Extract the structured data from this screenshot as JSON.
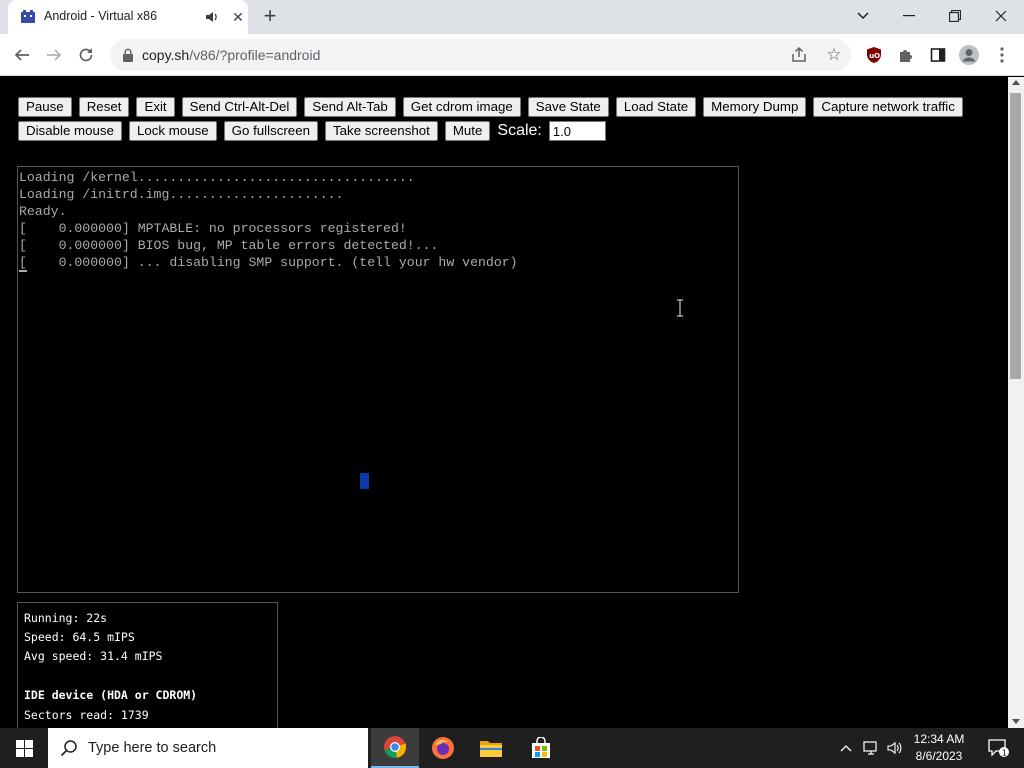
{
  "browser": {
    "tab_title": "Android - Virtual x86",
    "new_tab_symbol": "+",
    "close_tab_symbol": "✕",
    "url_host": "copy.sh",
    "url_rest": "/v86/?profile=android",
    "icons": [
      "v86-favicon-icon",
      "audio-playing-icon",
      "back-icon",
      "forward-icon",
      "reload-icon",
      "lock-icon",
      "share-icon",
      "star-icon",
      "ublock-icon",
      "extensions-icon",
      "side-panel-icon",
      "profile-icon",
      "menu-icon",
      "minimize-icon",
      "maximize-icon",
      "close-icon",
      "tab-search-icon"
    ]
  },
  "controls": {
    "row1": [
      "Pause",
      "Reset",
      "Exit",
      "Send Ctrl-Alt-Del",
      "Send Alt-Tab",
      "Get cdrom image",
      "Save State",
      "Load State",
      "Memory Dump",
      "Capture network traffic"
    ],
    "row2": [
      "Disable mouse",
      "Lock mouse",
      "Go fullscreen",
      "Take screenshot",
      "Mute"
    ],
    "scale_label": "Scale:",
    "scale_value": "1.0"
  },
  "terminal": {
    "lines": [
      "Loading /kernel...................................",
      "Loading /initrd.img......................",
      "Ready.",
      "[    0.000000] MPTABLE: no processors registered!",
      "[    0.000000] BIOS bug, MP table errors detected!...",
      "[    0.000000] ... disabling SMP support. (tell your hw vendor)"
    ]
  },
  "stats": {
    "running": "Running: 22s",
    "speed": "Speed: 64.5 mIPS",
    "avg_speed": "Avg speed: 31.4 mIPS",
    "ide_heading": "IDE device (HDA or CDROM)",
    "sectors_read": "Sectors read: 1739"
  },
  "taskbar": {
    "search_placeholder": "Type here to search",
    "time": "12:34 AM",
    "date": "8/6/2023",
    "notification_count": "1"
  },
  "colors": {
    "page_background": "#000000",
    "terminal_text": "#aaaaaa",
    "tab_strip": "#dee1e6",
    "taskbar": "#1f1f1f"
  }
}
